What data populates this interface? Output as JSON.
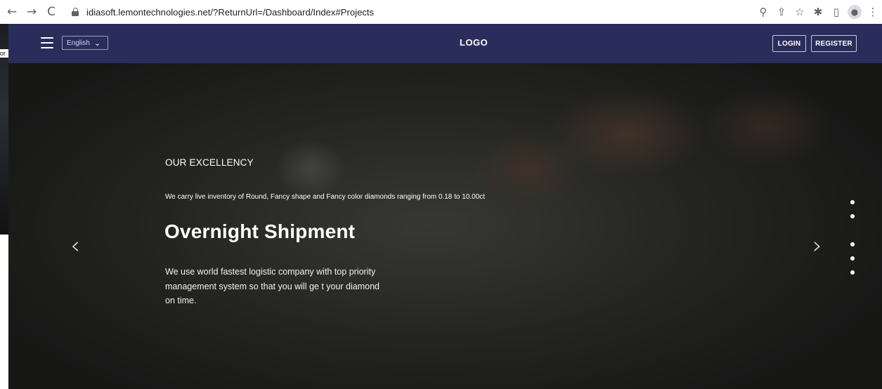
{
  "browser": {
    "url": "idiasoft.lemontechnologies.net/?ReturnUrl=/Dashboard/Index#Projects",
    "icons": [
      "back-icon",
      "forward-icon",
      "reload-icon",
      "lock-icon",
      "zoom-icon",
      "share-icon",
      "bookmark-star-icon",
      "extensions-icon",
      "side-panel-icon",
      "profile-icon",
      "menu-icon"
    ]
  },
  "background_window": {
    "fragment_text": "or"
  },
  "header": {
    "language_selected": "English",
    "logo_text": "LOGO",
    "login_label": "LOGIN",
    "register_label": "REGISTER",
    "background_color": "#2a2d5b"
  },
  "hero": {
    "eyebrow": "OUR EXCELLENCY",
    "small_description": "We carry live inventory of Round, Fancy shape and Fancy color diamonds ranging from 0.18 to 10.00ct",
    "headline": "Overnight Shipment",
    "description": "We use world fastest logistic company with top priority management system so that you will ge t your diamond on time.",
    "prev_arrow": "‹",
    "next_arrow": "›",
    "slide_indicators": 5,
    "active_slide": 3
  }
}
